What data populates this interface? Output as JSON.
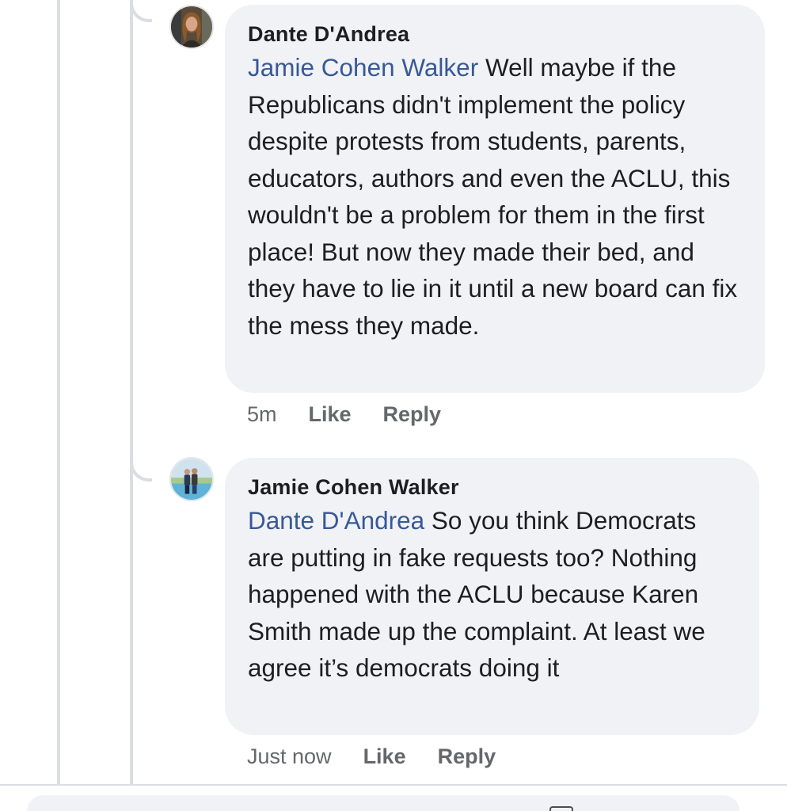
{
  "comments": [
    {
      "author": "Dante D'Andrea",
      "mention": "Jamie Cohen Walker",
      "text": " Well maybe if the Republicans didn't implement the policy despite protests from students, parents, educators, authors and even the ACLU, this wouldn't be a problem for them in the first place! But now they made their bed, and they have to lie in it until a new board can fix the mess they made.",
      "time": "5m",
      "like_label": "Like",
      "reply_label": "Reply"
    },
    {
      "author": "Jamie Cohen Walker",
      "mention": "Dante D'Andrea",
      "text": " So you think Democrats are putting in fake requests too?  Nothing happened with the ACLU because Karen Smith made up the complaint. At least we agree it’s democrats doing it",
      "time": "Just now",
      "like_label": "Like",
      "reply_label": "Reply"
    }
  ],
  "colors": {
    "bubble": "#f0f2f5",
    "mention": "#385898",
    "meta": "#65676b",
    "text": "#1c1e21",
    "thread_line": "#dadde1"
  },
  "icons": {
    "composer": "camera-icon"
  }
}
